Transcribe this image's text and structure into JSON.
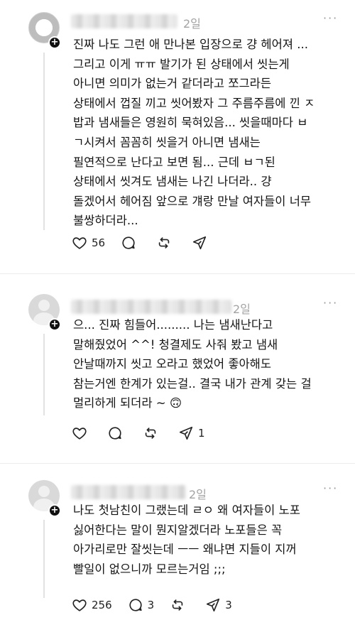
{
  "posts": [
    {
      "time": "2일",
      "text": "진짜 나도 그런 애 만나본 입장으로 걍 헤어져 ...\n그리고 이게 ㅠㅠ 발기가 된 상태에서 씻는게\n아니면 의미가 없는거 같더라고 쪼그라든\n상태에서 껍질 끼고 씻어봤자 그 주름주름에 낀 ㅈ\n밥과 냄새들은 영원히 묵혀있음... 씻을때마다 ㅂ\nㄱ시켜서 꼼꼼히 씻을거 아니면 냄새는\n필연적으로 난다고 보면 됨... 근데 ㅂㄱ된\n상태에서 씻겨도 냄새는 나긴 나더라.. 걍\n돌겠어서 헤어짐 앞으로 걔랑 만날 여자들이 너무\n불쌍하더라...",
      "likes": "56",
      "replies": "",
      "shares": ""
    },
    {
      "time": "2일",
      "text": "으... 진짜 힘들어......... 나는 냄새난다고\n말해줬었어 ^^! 청결제도 사줘 봤고 냄새\n안날때까지 씻고 오라고 했었어 좋아해도\n참는거엔 한계가 있는걸.. 결국 내가 관계 갖는 걸\n멀리하게 되더라 ~ 🙃",
      "likes": "",
      "replies": "",
      "shares": "1"
    },
    {
      "time": "2일",
      "text": "나도 첫남친이 그랬는데 ㄹㅇ 왜 여자들이 노포\n싫어한다는 말이 뭔지알겠더라 노포들은 꼭\n아가리로만 잘씻는데 ㅡㅡ 왜냐면 지들이 지꺼\n빨일이 없으니까 모르는거임 ;;;",
      "likes": "256",
      "replies": "3",
      "shares": "3"
    }
  ],
  "icons": {
    "more": "more-dots-icon",
    "like": "heart-icon",
    "reply": "comment-icon",
    "repost": "repost-icon",
    "share": "send-icon",
    "follow": "plus-icon"
  }
}
